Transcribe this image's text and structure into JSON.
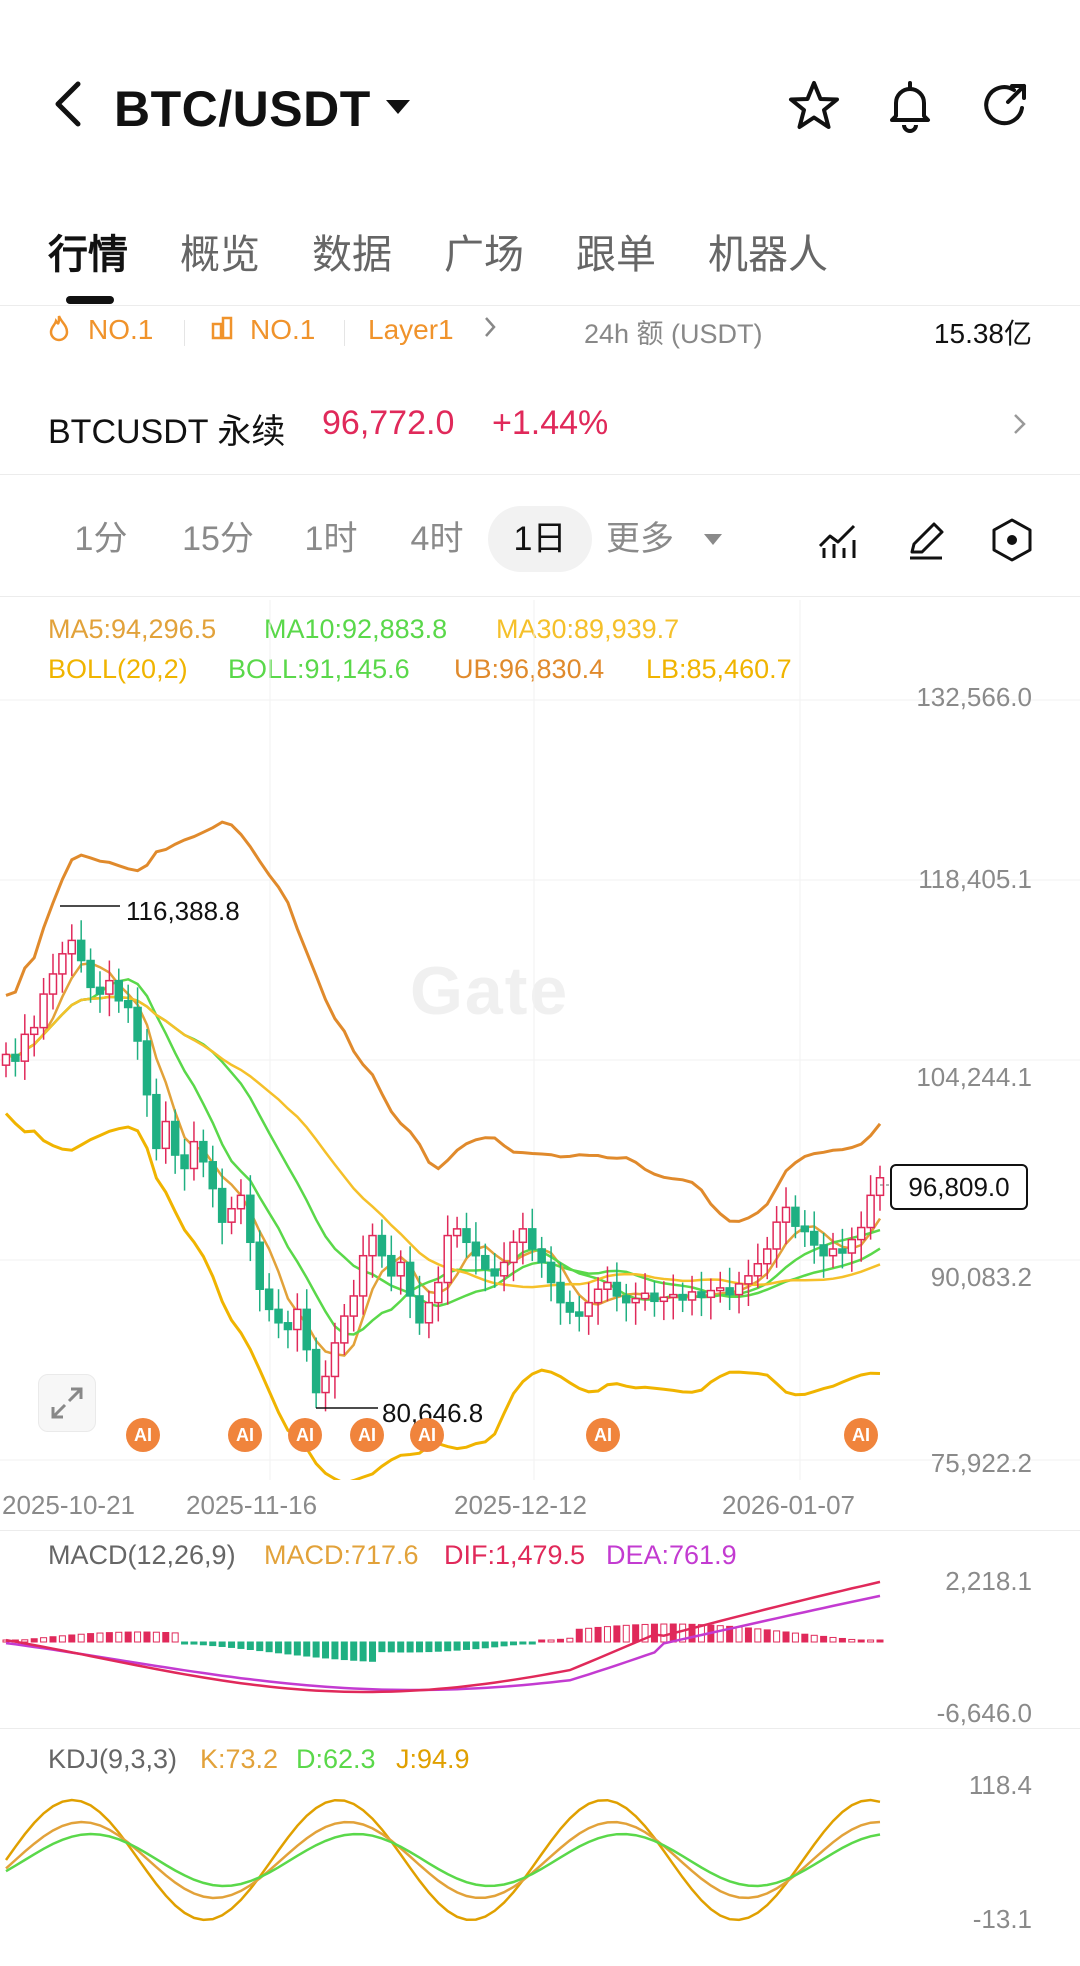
{
  "header": {
    "pair": "BTC/USDT"
  },
  "tabs": [
    {
      "label": "行情",
      "active": true
    },
    {
      "label": "概览",
      "active": false
    },
    {
      "label": "数据",
      "active": false
    },
    {
      "label": "广场",
      "active": false
    },
    {
      "label": "跟单",
      "active": false
    },
    {
      "label": "机器人",
      "active": false
    }
  ],
  "tags": {
    "rank1": "NO.1",
    "rank2": "NO.1",
    "category": "Layer1",
    "volume_label": "24h 额 (USDT)",
    "volume_value": "15.38亿"
  },
  "perp": {
    "name": "BTCUSDT 永续",
    "price": "96,772.0",
    "change": "+1.44%"
  },
  "timeframes": {
    "items": [
      "1分",
      "15分",
      "1时",
      "4时",
      "1日"
    ],
    "active": "1日",
    "more": "更多"
  },
  "indicators": {
    "ma5": "MA5:94,296.5",
    "ma10": "MA10:92,883.8",
    "ma30": "MA30:89,939.7",
    "boll": "BOLL(20,2)",
    "boll_mid": "BOLL:91,145.6",
    "ub": "UB:96,830.4",
    "lb": "LB:85,460.7",
    "macd_name": "MACD(12,26,9)",
    "macd": "MACD:717.6",
    "dif": "DIF:1,479.5",
    "dea": "DEA:761.9",
    "kdj_name": "KDJ(9,3,3)",
    "k": "K:73.2",
    "d": "D:62.3",
    "j": "J:94.9"
  },
  "price_axis": [
    "132,566.0",
    "118,405.1",
    "104,244.1",
    "90,083.2",
    "75,922.2"
  ],
  "date_axis": [
    "2025-10-21",
    "2025-11-16",
    "2025-12-12",
    "2026-01-07"
  ],
  "macd_axis": [
    "2,218.1",
    "-6,646.0"
  ],
  "kdj_axis": [
    "118.4",
    "-13.1"
  ],
  "annotations": {
    "high": "116,388.8",
    "low": "80,646.8",
    "last": "96,809.0"
  },
  "ai_badge": "AI",
  "watermark": "Gate",
  "colors": {
    "up": "#e0295a",
    "down": "#1fb082",
    "ma5": "#e2a23a",
    "ma10": "#5ad84a",
    "ma30": "#f5c02a",
    "ub": "#e08a2c",
    "lb": "#f0b400",
    "dif": "#e0a000",
    "dea": "#c33bd1",
    "accent": "#f0932b"
  },
  "chart_data": {
    "type": "candlestick",
    "ylim": [
      75922.2,
      132566.0
    ],
    "high": 116388.8,
    "low": 80646.8,
    "last": 96809.0,
    "macd_ylim": [
      -6646.0,
      2218.1
    ],
    "kdj_ylim": [
      -13.1,
      118.4
    ]
  }
}
